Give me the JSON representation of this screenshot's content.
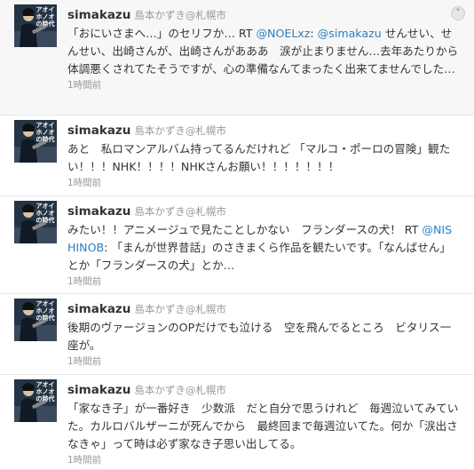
{
  "tweets": [
    {
      "screen_name": "simakazu",
      "full_name": "島本かずき@札幌市",
      "segments": [
        {
          "t": "「おにいさまへ…」のセリフか… RT "
        },
        {
          "t": "@NOELxz",
          "m": true
        },
        {
          "t": ": "
        },
        {
          "t": "@simakazu",
          "m": true
        },
        {
          "t": " せんせい、せんせい、出崎さんが、出崎さんがあああ　涙が止まりません…去年あたりから体調悪くされてたそうですが、心の準備なんてまったく出来てませんでした…"
        }
      ],
      "time": "1時間前"
    },
    {
      "screen_name": "simakazu",
      "full_name": "島本かずき@札幌市",
      "segments": [
        {
          "t": "あと　私ロマンアルバム持ってるんだけれど 「マルコ・ポーロの冒険」観たい！！！NHK！！！！NHKさんお願い！！！！！！！"
        }
      ],
      "time": "1時間前"
    },
    {
      "screen_name": "simakazu",
      "full_name": "島本かずき@札幌市",
      "segments": [
        {
          "t": "みたい！！アニメージュで見たことしかない　フランダースの犬！ RT "
        },
        {
          "t": "@NISHINOB",
          "m": true
        },
        {
          "t": ": 「まんが世界昔話」のさきまくら作品を観たいです。「なんばせん」とか「フランダースの犬」とか…"
        }
      ],
      "time": "1時間前"
    },
    {
      "screen_name": "simakazu",
      "full_name": "島本かずき@札幌市",
      "segments": [
        {
          "t": "後期のヴァージョンのOPだけでも泣ける　空を飛んでるところ　ビタリス一座が。"
        }
      ],
      "time": "1時間前"
    },
    {
      "screen_name": "simakazu",
      "full_name": "島本かずき@札幌市",
      "segments": [
        {
          "t": "「家なき子」が一番好き　少数派　だと自分で思うけれど　毎週泣いてみていた。カルロバルザーニが死んでから　最終回まで毎週泣いてた。何か「涙出さなきゃ」って時は必ず家なき子思い出してる。"
        }
      ],
      "time": "1時間前"
    }
  ],
  "avatar_text": [
    "アオイ",
    "ホノオ",
    "の時代"
  ],
  "expand_icon": "chevron-down-icon"
}
